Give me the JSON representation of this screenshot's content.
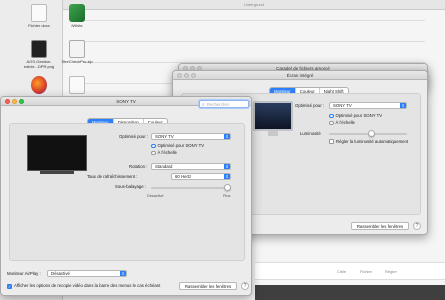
{
  "desktop": {
    "icons": [
      {
        "label": "Fichier docx",
        "kind": "doc"
      },
      {
        "label": "iWhite",
        "kind": "app"
      },
      {
        "label": "AGS-Gestion-edicte...DPR.png",
        "kind": "img"
      },
      {
        "label": "StreCheckPro.zip",
        "kind": "zip"
      },
      {
        "label": "",
        "kind": "ff"
      },
      {
        "label": "",
        "kind": "doc"
      }
    ]
  },
  "background_window": {
    "title": "Untergrund",
    "bar_items": [
      "Cible",
      "Fichier",
      "Régler"
    ]
  },
  "main_window": {
    "title": "SONY TV",
    "search_placeholder": "Rechercher",
    "tabs": [
      "Moniteur",
      "Disposition",
      "Couleur"
    ],
    "active_tab": "Moniteur",
    "optimise_label": "Optimisé pour :",
    "optimise_value": "SONY TV",
    "radio_optimise": "Optimisé pour SONY TV",
    "radio_scaled": "À l'échelle",
    "rotation_label": "Rotation :",
    "rotation_value": "Standard",
    "refresh_label": "Taux de rafraîchissement :",
    "refresh_value": "60 Hertz",
    "underscan_label": "Sous-balayage :",
    "underscan_min": "Désactivé",
    "underscan_max": "Plus",
    "underscan_level": 0.95,
    "airplay_label": "Moniteur AirPlay :",
    "airplay_value": "Désactivé",
    "mirror_checkbox": "Afficher les options de recopie vidéo dans la barre des menus le cas échéant",
    "mirror_checked": true,
    "gather_button": "Rassembler les fenêtres",
    "help": "?"
  },
  "second_window": {
    "title": "Écran intégré",
    "tabs": [
      "Moniteur",
      "Couleur",
      "Night Shift"
    ],
    "active_tab": "Moniteur",
    "optimise_label": "Optimisé pour :",
    "optimise_value": "SONY TV",
    "radio_optimise": "Optimisé pour SONY TV",
    "radio_scaled": "À l'échelle",
    "brightness_label": "Luminosité",
    "brightness_level": 0.55,
    "auto_brightness": "Régler la luminosité automatiquement",
    "gather_button": "Rassembler les fenêtres",
    "help": "?"
  },
  "third_window": {
    "title": "Caradel de fichiers amorcé"
  }
}
